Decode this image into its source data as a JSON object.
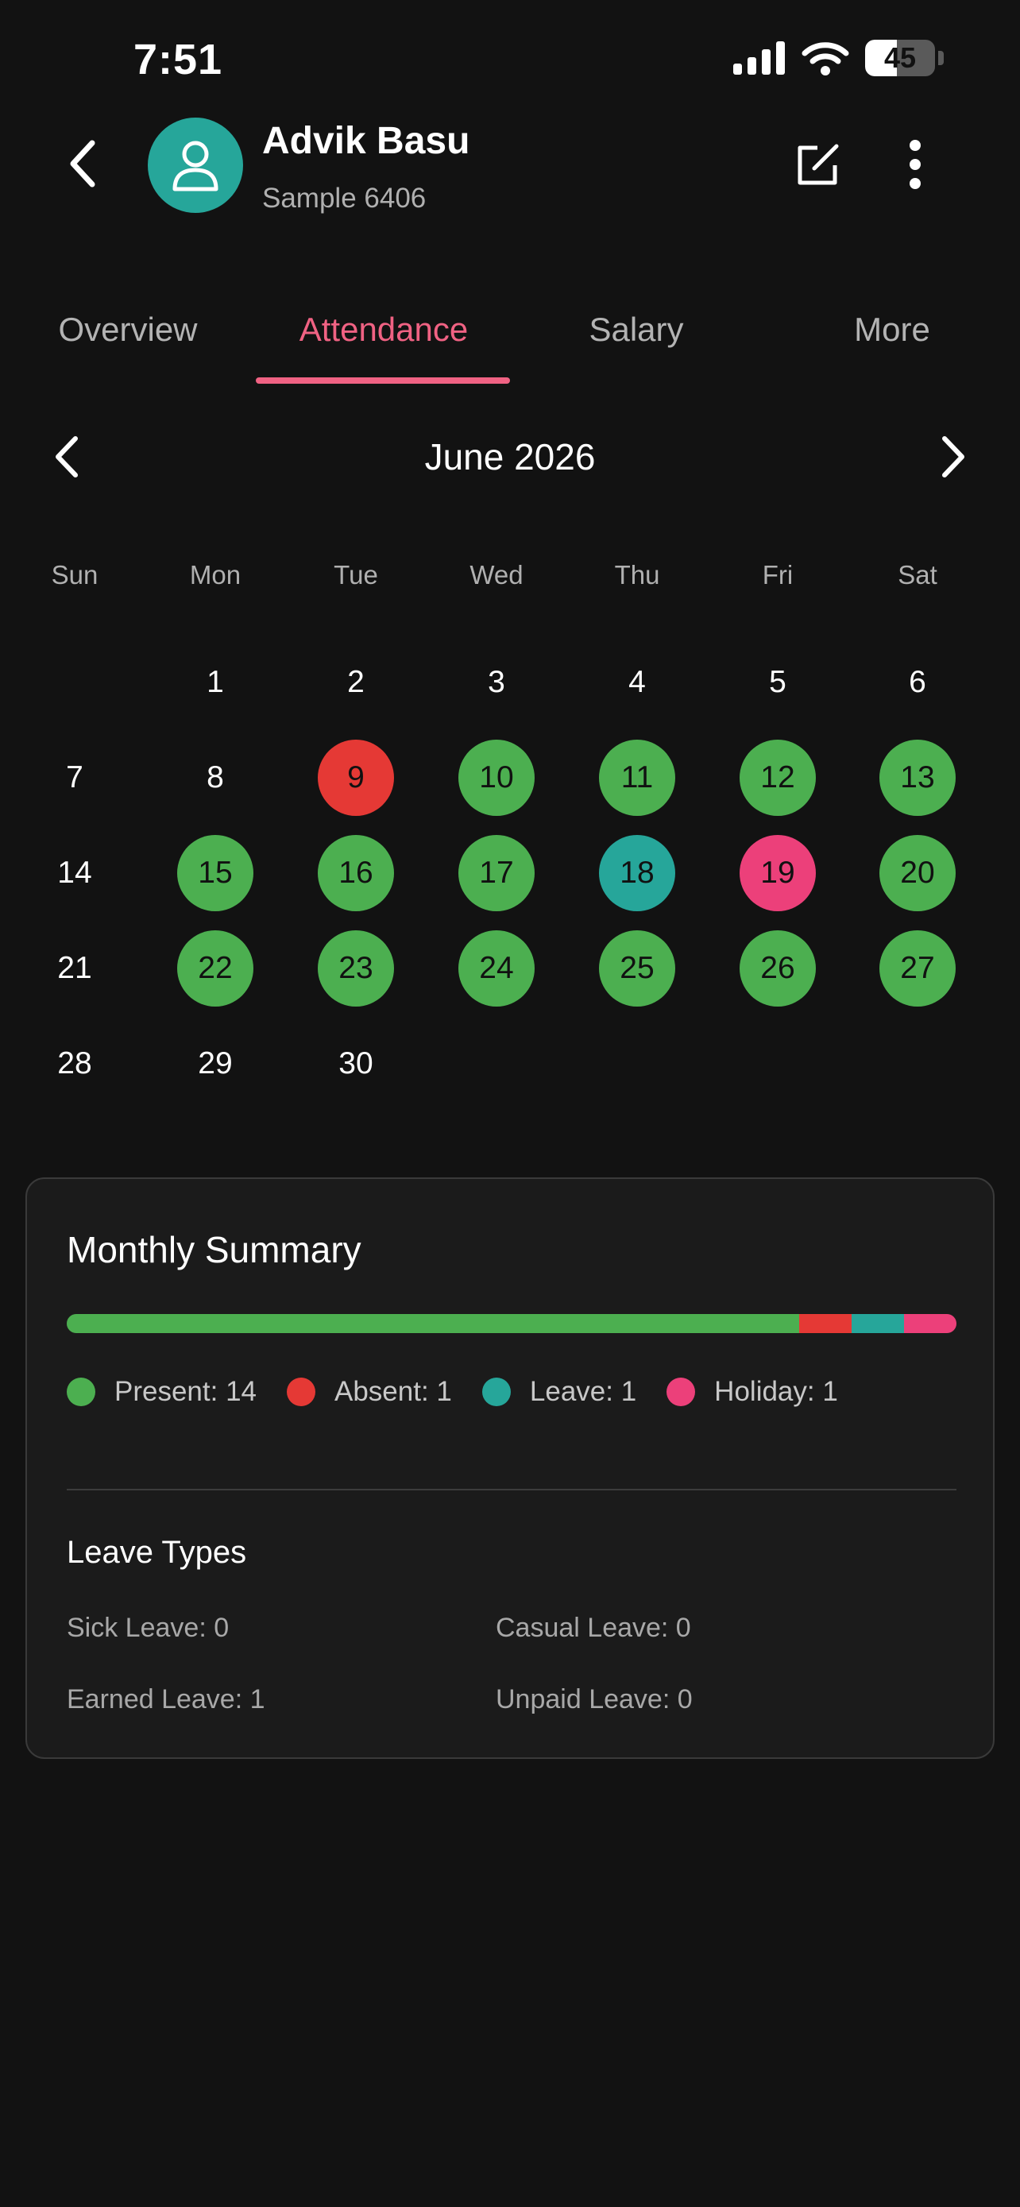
{
  "status_bar": {
    "time": "7:51",
    "battery_level": 45,
    "battery_text": "45"
  },
  "header": {
    "name": "Advik Basu",
    "id_text": "Sample 6406"
  },
  "tabs": [
    {
      "label": "Overview",
      "active": false
    },
    {
      "label": "Attendance",
      "active": true
    },
    {
      "label": "Salary",
      "active": false
    },
    {
      "label": "More",
      "active": false
    }
  ],
  "calendar": {
    "month_title": "June 2026",
    "first_weekday": 1,
    "days_in_month": 30,
    "weekdays": [
      "Sun",
      "Mon",
      "Tue",
      "Wed",
      "Thu",
      "Fri",
      "Sat"
    ],
    "status": {
      "9": "absent",
      "10": "present",
      "11": "present",
      "12": "present",
      "13": "present",
      "15": "present",
      "16": "present",
      "17": "present",
      "18": "leave",
      "19": "holiday",
      "20": "present",
      "22": "present",
      "23": "present",
      "24": "present",
      "25": "present",
      "26": "present",
      "27": "present"
    }
  },
  "colors": {
    "present": "#4caf50",
    "absent": "#e53935",
    "leave": "#26a69a",
    "holiday": "#ec407a",
    "accent": "#f06283"
  },
  "summary": {
    "title": "Monthly Summary",
    "segments": [
      {
        "key": "present",
        "count": 14,
        "label": "Present: 14"
      },
      {
        "key": "absent",
        "count": 1,
        "label": "Absent: 1"
      },
      {
        "key": "leave",
        "count": 1,
        "label": "Leave: 1"
      },
      {
        "key": "holiday",
        "count": 1,
        "label": "Holiday: 1"
      }
    ]
  },
  "leave_types": {
    "title": "Leave Types",
    "items": [
      {
        "label": "Sick Leave: 0"
      },
      {
        "label": "Casual Leave: 0"
      },
      {
        "label": "Earned Leave: 1"
      },
      {
        "label": "Unpaid Leave: 0"
      }
    ]
  }
}
